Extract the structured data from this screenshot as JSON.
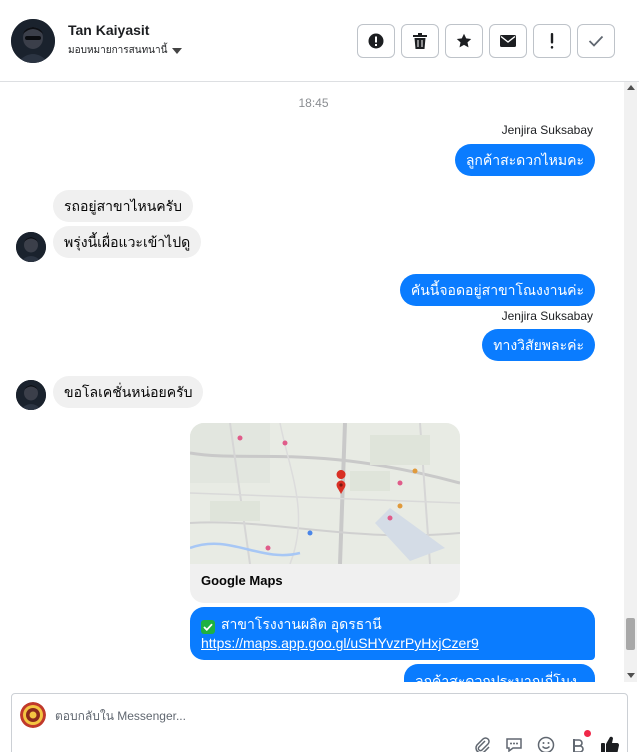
{
  "header": {
    "contact_name": "Tan Kaiyasit",
    "assign_label": "มอบหมายการสนทนานี้",
    "toolbar_icons": [
      "alert-circle-icon",
      "trash-icon",
      "star-icon",
      "envelope-icon",
      "exclamation-icon",
      "check-icon"
    ]
  },
  "thread": {
    "timestamp": "18:45",
    "messages": [
      {
        "direction": "out",
        "sender": "Jenjira Suksabay",
        "text": "ลูกค้าสะดวกไหมคะ"
      },
      {
        "direction": "in",
        "text": "รถอยู่สาขาไหนครับ"
      },
      {
        "direction": "in",
        "text": "พรุ่งนี้เผื่อแวะเข้าไปดู"
      },
      {
        "direction": "out",
        "text": "คันนี้จอดอยู่สาขาโณงงานค่ะ"
      },
      {
        "direction": "out",
        "sender": "Jenjira Suksabay",
        "text": "ทางวิสัยพละค่ะ"
      },
      {
        "direction": "in",
        "text": "ขอโลเคชั่นหน่อยครับ"
      }
    ],
    "map_card": {
      "title": "Google Maps"
    },
    "link_message": {
      "title": "สาขาโรงงานผลิต อุดรธานี",
      "url": "https://maps.app.goo.gl/uSHYvzrPyHxjCzer9"
    },
    "cut_message": "ลูกค้าสะดวกประมาณกี่โมงคะ"
  },
  "composer": {
    "placeholder": "ตอบกลับใน Messenger...",
    "icons": [
      "attachment-icon",
      "saved-replies-icon",
      "emoji-icon",
      "bot-icon",
      "like-icon"
    ]
  },
  "colors": {
    "outgoing": "#0a7cff",
    "incoming": "#f0f0f0",
    "check": "#1fb141",
    "notification_dot": "#f02849"
  }
}
